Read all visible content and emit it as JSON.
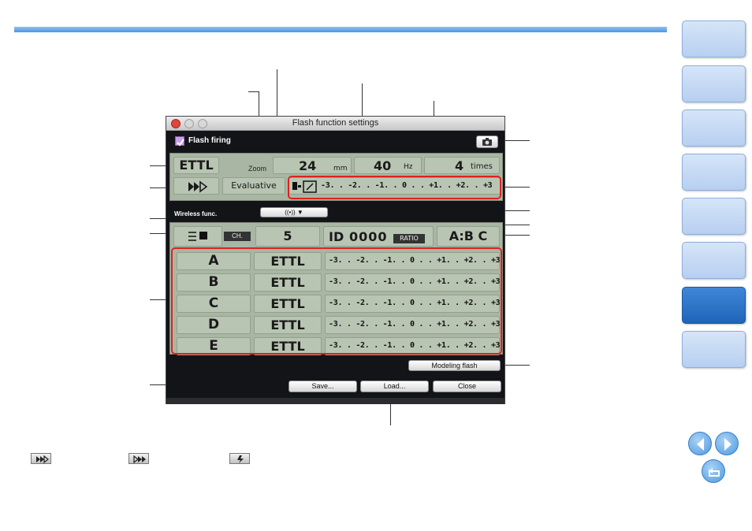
{
  "window": {
    "title": "Flash function settings",
    "flash_firing_label": "Flash firing",
    "mode": "ETTL",
    "zoom_label": "Zoom",
    "zoom_value": "24",
    "zoom_unit": "mm",
    "hz_value": "40",
    "hz_unit": "Hz",
    "times_value": "4",
    "times_unit": "times",
    "metering": "Evaluative",
    "exposure_scale": "-3. . -2. . -1. . 0 . . +1. . +2. . +3",
    "wireless_label": "Wireless func.",
    "wireless_dropdown": "((•))  ▼",
    "channel_label": "CH.",
    "channel_value": "5",
    "id_label": "ID",
    "id_value": "0000",
    "ratio_label": "RATIO",
    "ratio_value": "A:B C",
    "groups": [
      {
        "name": "A",
        "mode": "ETTL"
      },
      {
        "name": "B",
        "mode": "ETTL"
      },
      {
        "name": "C",
        "mode": "ETTL"
      },
      {
        "name": "D",
        "mode": "ETTL"
      },
      {
        "name": "E",
        "mode": "ETTL"
      }
    ],
    "modeling_flash": "Modeling flash",
    "save": "Save...",
    "load": "Load...",
    "close": "Close"
  },
  "icons": {
    "camera": "camera-icon",
    "high_speed_sync": "high-speed-sync-icon",
    "second_curtain": "second-curtain-icon",
    "wireless_slave": "wireless-icon"
  },
  "colors": {
    "accent": "#4f96e0",
    "highlight_box": "#e02020",
    "lcd": "#a9b6a4",
    "active_tab": "#2a6fc4"
  }
}
